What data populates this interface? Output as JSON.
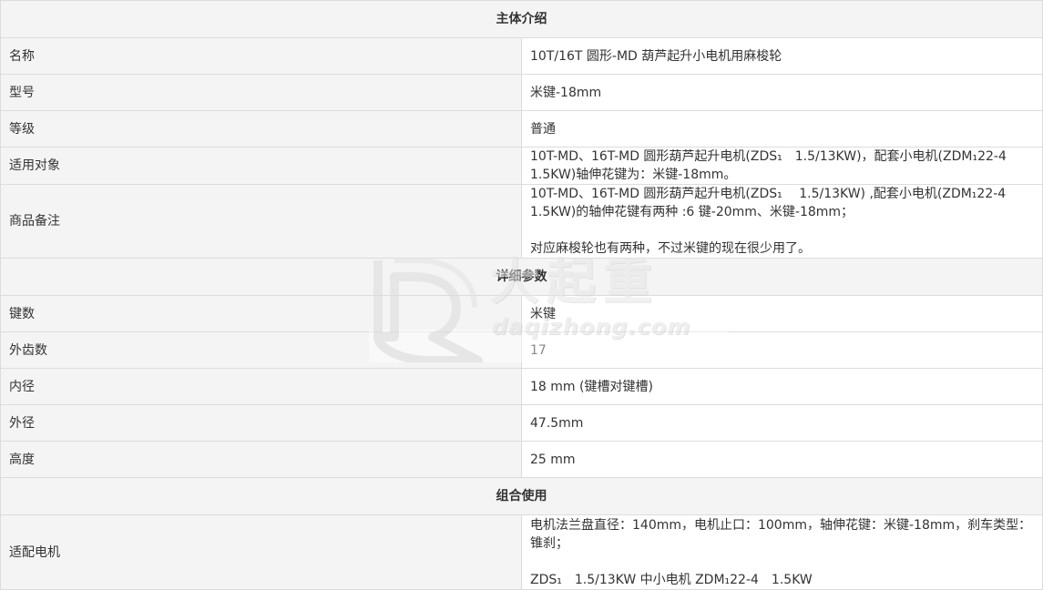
{
  "sections": {
    "intro": "主体介绍",
    "details": "详细参数",
    "combo": "组合使用"
  },
  "intro_rows": [
    {
      "label": "名称",
      "value": "10T/16T 圆形-MD 葫芦起升小电机用麻梭轮"
    },
    {
      "label": "型号",
      "value": "米键-18mm"
    },
    {
      "label": "等级",
      "value": "普通"
    },
    {
      "label": "适用对象",
      "value": "10T-MD、16T-MD 圆形葫芦起升电机(ZDS₁　1.5/13KW)，配套小电机(ZDM₁22-4　1.5KW)轴伸花键为：米键-18mm。"
    },
    {
      "label": "商品备注",
      "line1": "10T-MD、16T-MD 圆形葫芦起升电机(ZDS₁　 1.5/13KW) ,配套小电机(ZDM₁22-4　1.5KW)的轴伸花键有两种 :6 键-20mm、米键-18mm；",
      "line2": "对应麻梭轮也有两种，不过米键的现在很少用了。"
    }
  ],
  "detail_rows": [
    {
      "label": "键数",
      "value": "米键"
    },
    {
      "label": "外齿数",
      "value": "17"
    },
    {
      "label": "内径",
      "value": "18 mm (键槽对键槽)"
    },
    {
      "label": "外径",
      "value": "47.5mm"
    },
    {
      "label": "高度",
      "value": "25 mm"
    }
  ],
  "combo_rows": [
    {
      "label": "适配电机",
      "line1": "电机法兰盘直径：140mm，电机止口：100mm，轴伸花键：米键-18mm，刹车类型：锥刹；",
      "line2": "ZDS₁　1.5/13KW  中小电机 ZDM₁22-4　1.5KW"
    }
  ],
  "watermark": {
    "cn": "大起重",
    "en": "daqizhong.com"
  },
  "colors": {
    "border": "#dcdcdc",
    "label_bg": "#f4f4f4",
    "text": "#333333"
  }
}
